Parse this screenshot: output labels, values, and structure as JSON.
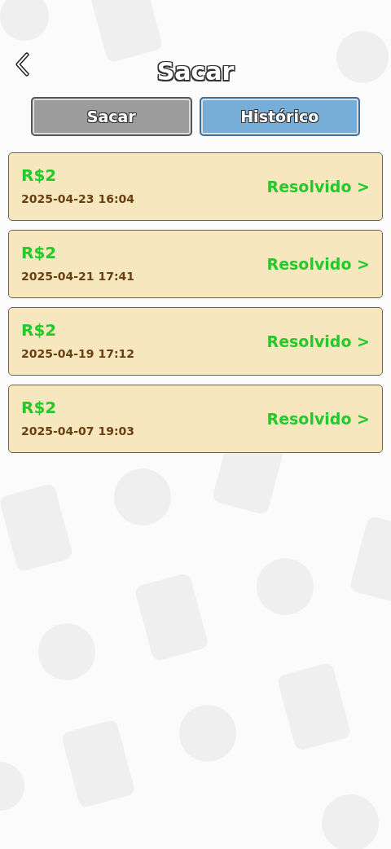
{
  "header": {
    "title": "Sacar"
  },
  "tabs": [
    {
      "label": "Sacar",
      "selected": false
    },
    {
      "label": "Histórico",
      "selected": true
    }
  ],
  "records": [
    {
      "amount": "R$2",
      "date": "2025-04-23 16:04",
      "status": "Resolvido >"
    },
    {
      "amount": "R$2",
      "date": "2025-04-21 17:41",
      "status": "Resolvido >"
    },
    {
      "amount": "R$2",
      "date": "2025-04-19 17:12",
      "status": "Resolvido >"
    },
    {
      "amount": "R$2",
      "date": "2025-04-07 19:03",
      "status": "Resolvido >"
    }
  ]
}
